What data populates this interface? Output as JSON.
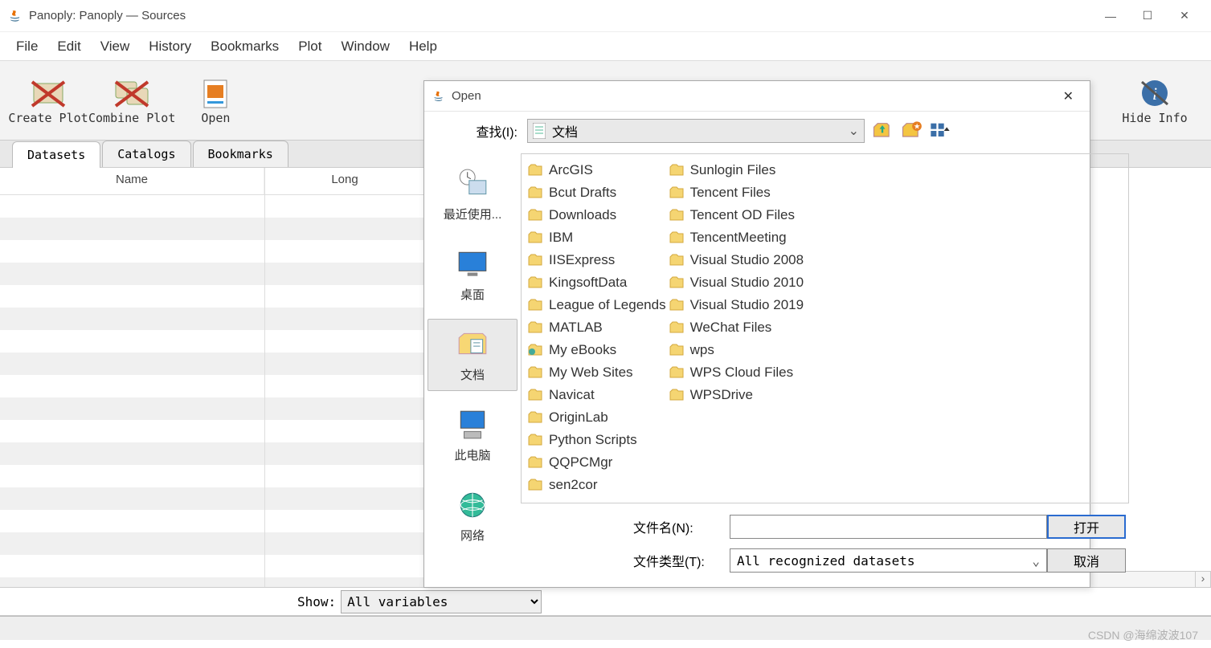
{
  "window": {
    "title": "Panoply: Panoply — Sources"
  },
  "menu": {
    "items": [
      "File",
      "Edit",
      "View",
      "History",
      "Bookmarks",
      "Plot",
      "Window",
      "Help"
    ]
  },
  "toolbar": {
    "create_plot": "Create Plot",
    "combine_plot": "Combine Plot",
    "open": "Open",
    "hide_info": "Hide Info"
  },
  "tabs": {
    "datasets": "Datasets",
    "catalogs": "Catalogs",
    "bookmarks": "Bookmarks"
  },
  "table": {
    "col_name": "Name",
    "col_long": "Long"
  },
  "bottom": {
    "show_label": "Show:",
    "show_value": "All variables"
  },
  "dialog": {
    "title": "Open",
    "lookin_label": "查找(I):",
    "lookin_value": "文档",
    "places": {
      "recent": "最近使用...",
      "desktop": "桌面",
      "documents": "文档",
      "computer": "此电脑",
      "network": "网络"
    },
    "files_col1": [
      "ArcGIS",
      "Bcut Drafts",
      "Downloads",
      "IBM",
      "IISExpress",
      "KingsoftData",
      "League of Legends",
      "MATLAB",
      "My eBooks",
      "My Web Sites",
      "Navicat",
      "OriginLab",
      "Python Scripts",
      "QQPCMgr",
      "sen2cor"
    ],
    "files_col2": [
      "Sunlogin Files",
      "Tencent Files",
      "Tencent OD Files",
      "TencentMeeting",
      "Visual Studio 2008",
      "Visual Studio 2010",
      "Visual Studio 2019",
      "WeChat Files",
      "wps",
      "WPS Cloud Files",
      "WPSDrive"
    ],
    "filename_label": "文件名(N):",
    "filename_value": "",
    "filetype_label": "文件类型(T):",
    "filetype_value": "All recognized datasets",
    "open_btn": "打开",
    "cancel_btn": "取消"
  },
  "watermark": "CSDN @海绵波波107"
}
